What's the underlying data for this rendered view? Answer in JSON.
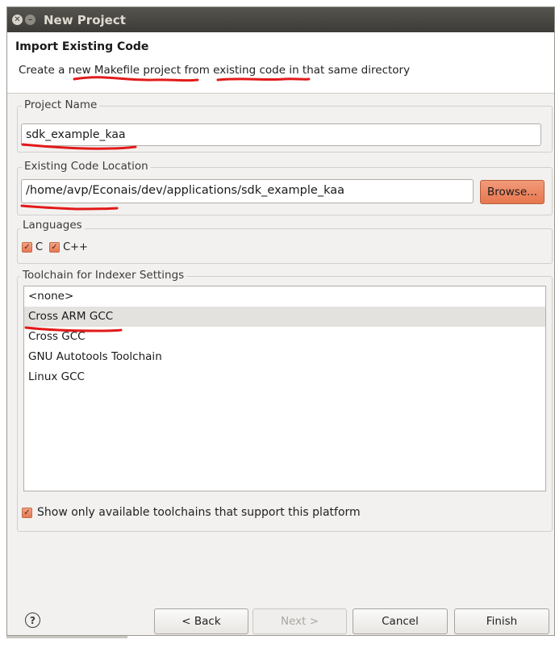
{
  "window": {
    "title": "New Project"
  },
  "header": {
    "title": "Import Existing Code",
    "description": "Create a new Makefile project from existing code in that same directory"
  },
  "project_name": {
    "label": "Project Name",
    "value": "sdk_example_kaa"
  },
  "code_location": {
    "label": "Existing Code Location",
    "value": "/home/avp/Econais/dev/applications/sdk_example_kaa",
    "browse_label": "Browse..."
  },
  "languages": {
    "label": "Languages",
    "items": [
      {
        "label": "C",
        "checked": true
      },
      {
        "label": "C++",
        "checked": true
      }
    ]
  },
  "toolchain": {
    "label": "Toolchain for Indexer Settings",
    "items": [
      "<none>",
      "Cross ARM GCC",
      "Cross GCC",
      "GNU Autotools Toolchain",
      "Linux GCC"
    ],
    "selected": "Cross ARM GCC",
    "show_only_label": "Show only available toolchains that support this platform",
    "show_only_checked": true
  },
  "buttons": {
    "help": "?",
    "back": "< Back",
    "next": "Next >",
    "cancel": "Cancel",
    "finish": "Finish"
  },
  "colors": {
    "accent": "#e7774f",
    "titlebar": "#3c3b37",
    "annotation": "#e21a1a"
  }
}
